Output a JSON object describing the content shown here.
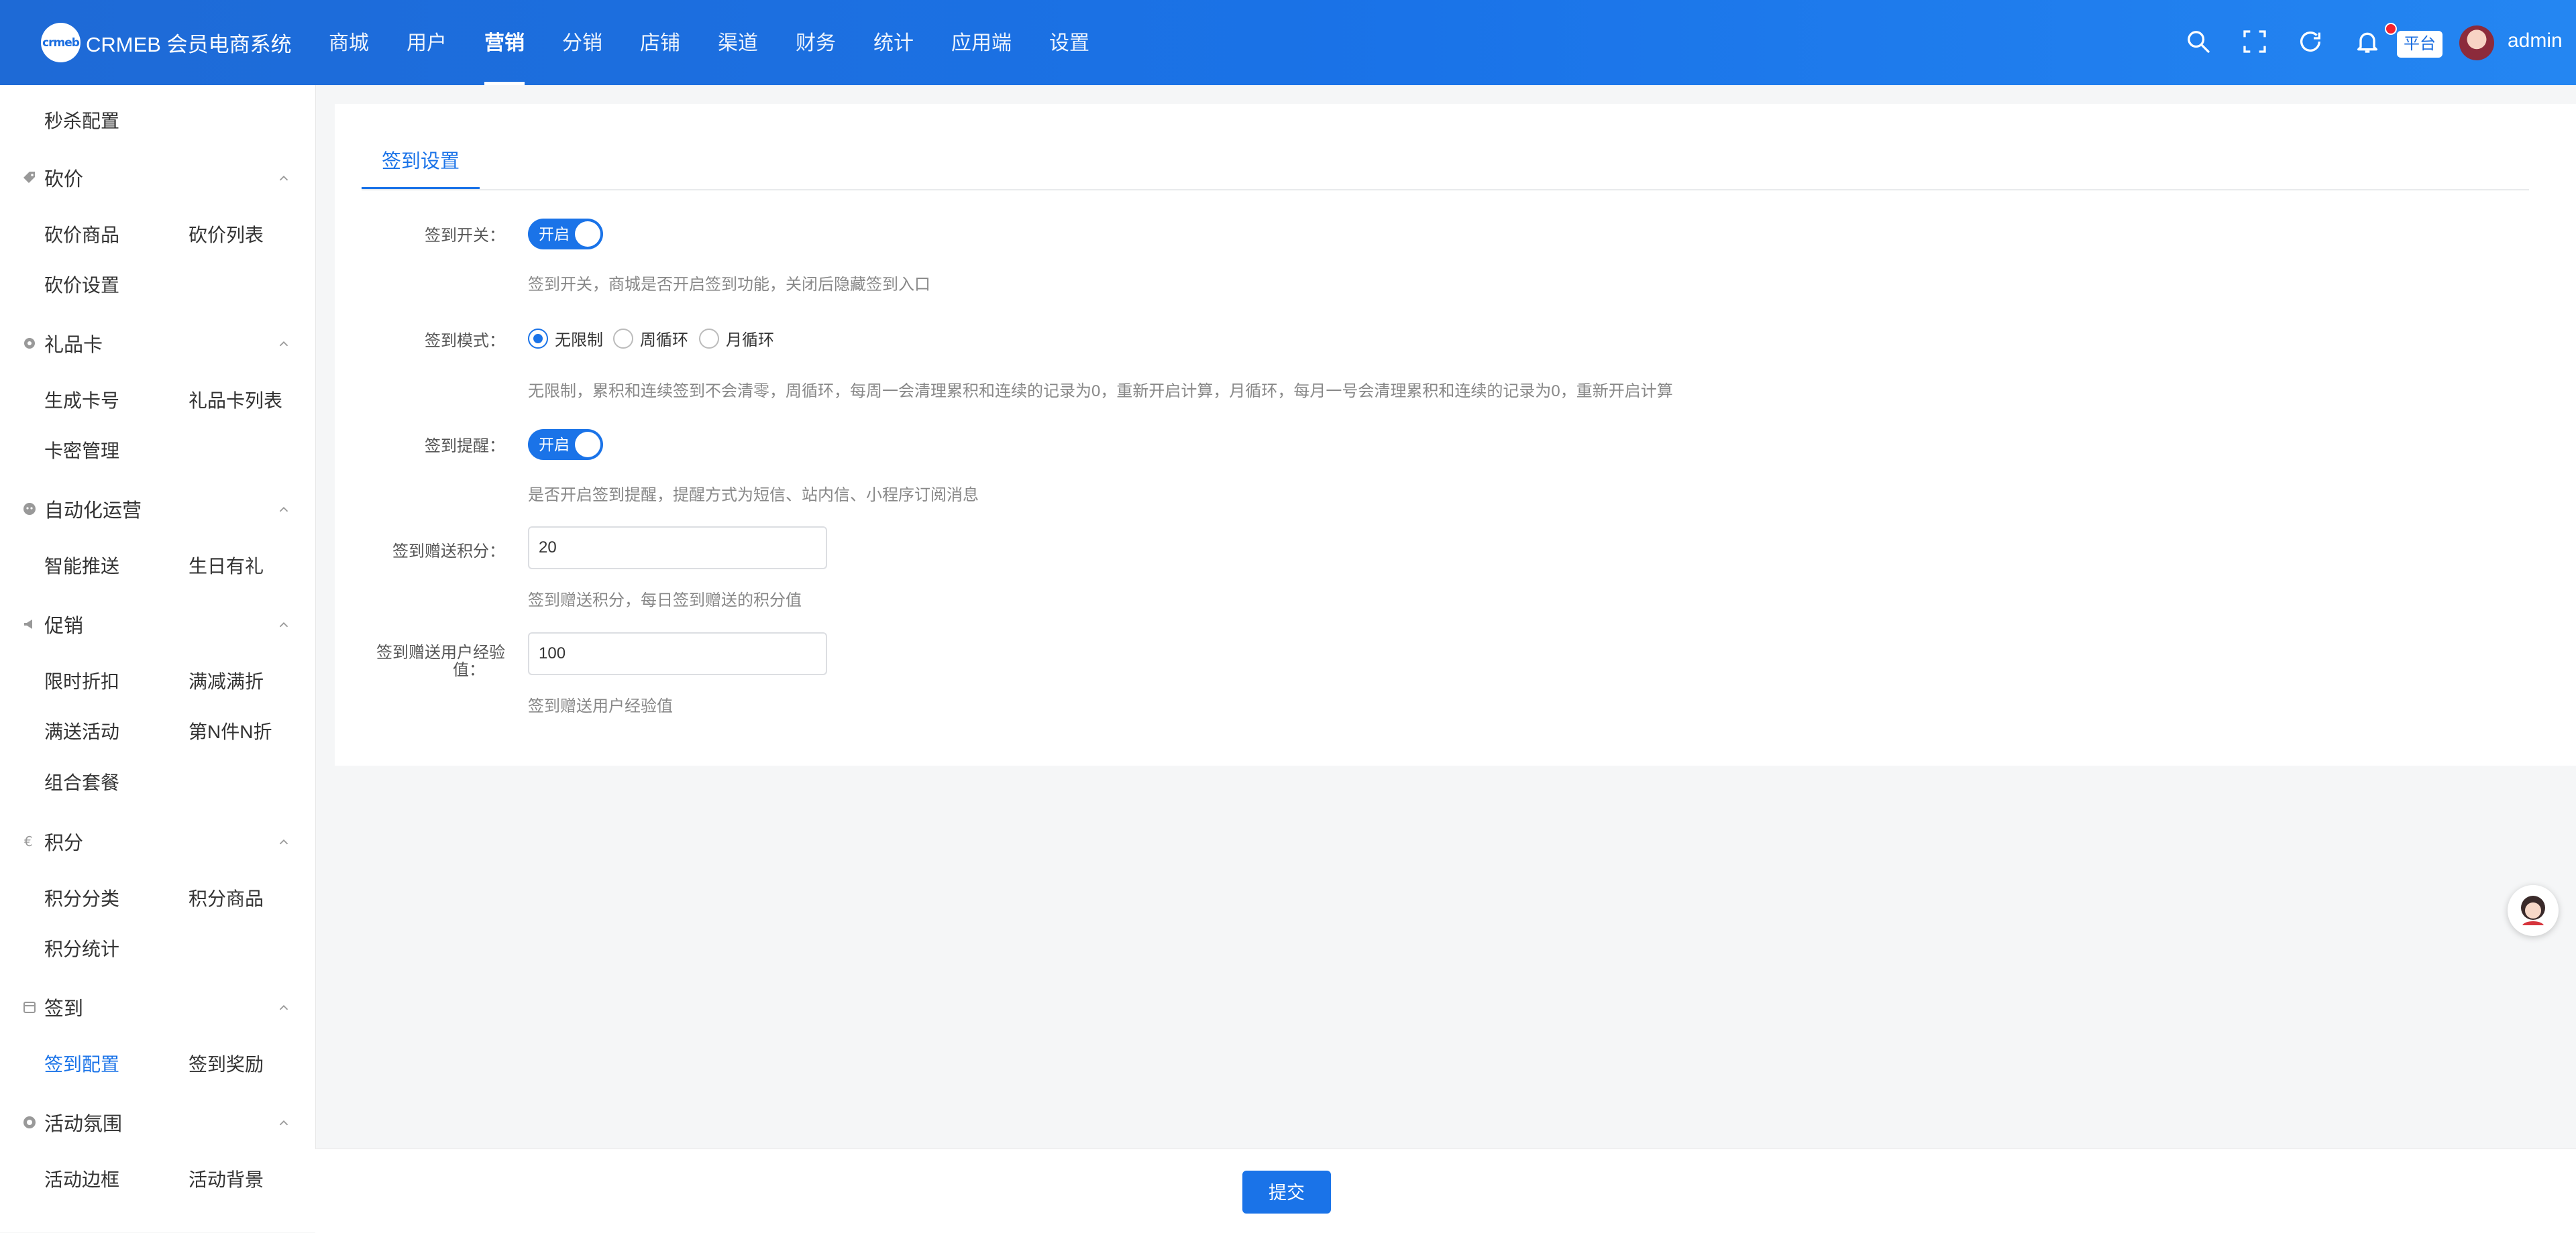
{
  "app": {
    "logo_mark": "crmeb",
    "title": "CRMEB 会员电商系统"
  },
  "topnav": [
    {
      "label": "商城"
    },
    {
      "label": "用户"
    },
    {
      "label": "营销",
      "active": true
    },
    {
      "label": "分销"
    },
    {
      "label": "店铺"
    },
    {
      "label": "渠道"
    },
    {
      "label": "财务"
    },
    {
      "label": "统计"
    },
    {
      "label": "应用端"
    },
    {
      "label": "设置"
    }
  ],
  "header": {
    "platform_tag": "平台",
    "username": "admin",
    "notification_dot": true
  },
  "sidebar": {
    "top_item": "秒杀配置",
    "groups": [
      {
        "label": "砍价",
        "icon": "tag-icon",
        "items": [
          "砍价商品",
          "砍价列表",
          "砍价设置"
        ]
      },
      {
        "label": "礼品卡",
        "icon": "gear-icon",
        "items": [
          "生成卡号",
          "礼品卡列表",
          "卡密管理"
        ]
      },
      {
        "label": "自动化运营",
        "icon": "robot-icon",
        "items": [
          "智能推送",
          "生日有礼"
        ]
      },
      {
        "label": "促销",
        "icon": "megaphone-icon",
        "items": [
          "限时折扣",
          "满减满折",
          "满送活动",
          "第N件N折",
          "组合套餐"
        ]
      },
      {
        "label": "积分",
        "icon": "euro-icon",
        "items": [
          "积分分类",
          "积分商品",
          "积分统计"
        ]
      },
      {
        "label": "签到",
        "icon": "calendar-icon",
        "items": [
          "签到配置",
          "签到奖励"
        ],
        "active_item": "签到配置"
      },
      {
        "label": "活动氛围",
        "icon": "palette-icon",
        "items": [
          "活动边框",
          "活动背景"
        ]
      }
    ]
  },
  "tab": {
    "label": "签到设置"
  },
  "form": {
    "sign_switch": {
      "label": "签到开关：",
      "state": "开启",
      "on": true,
      "help": "签到开关，商城是否开启签到功能，关闭后隐藏签到入口"
    },
    "sign_mode": {
      "label": "签到模式：",
      "options": [
        "无限制",
        "周循环",
        "月循环"
      ],
      "selected": "无限制",
      "help": "无限制，累积和连续签到不会清零，周循环，每周一会清理累积和连续的记录为0，重新开启计算，月循环，每月一号会清理累积和连续的记录为0，重新开启计算"
    },
    "sign_remind": {
      "label": "签到提醒：",
      "state": "开启",
      "on": true,
      "help": "是否开启签到提醒，提醒方式为短信、站内信、小程序订阅消息"
    },
    "sign_points": {
      "label": "签到赠送积分：",
      "value": "20",
      "help": "签到赠送积分，每日签到赠送的积分值"
    },
    "sign_exp": {
      "label_line1": "签到赠送用户经验",
      "label_line2": "值：",
      "value": "100",
      "help": "签到赠送用户经验值"
    }
  },
  "footer": {
    "submit_label": "提交"
  },
  "colors": {
    "primary": "#1a73e8",
    "header_gradient_start": "#1e6ad6",
    "header_gradient_end": "#2486f2",
    "page_bg": "#f5f6f7"
  }
}
